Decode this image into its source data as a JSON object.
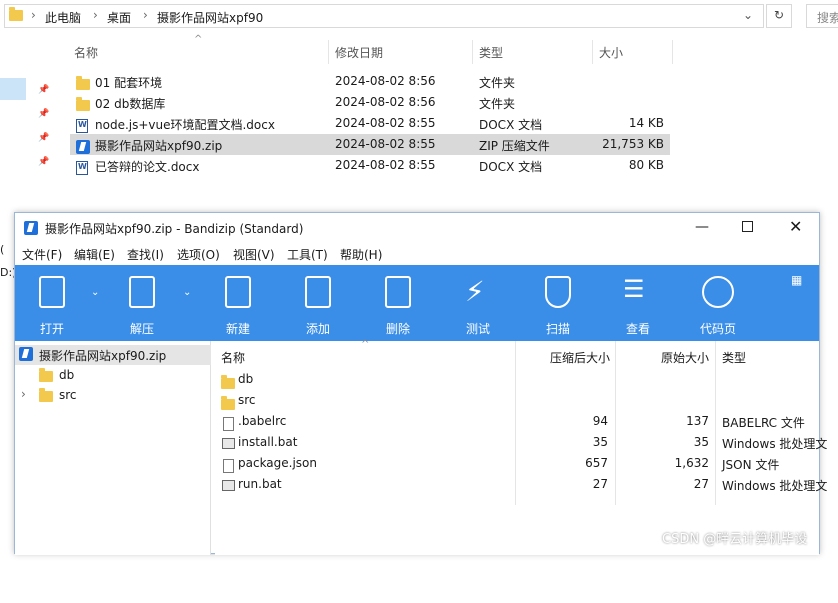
{
  "explorer": {
    "breadcrumb": [
      "此电脑",
      "桌面",
      "摄影作品网站xpf90"
    ],
    "search_placeholder": "搜索",
    "columns": {
      "name": "名称",
      "modified": "修改日期",
      "type": "类型",
      "size": "大小"
    },
    "files": [
      {
        "name": "01  配套环境",
        "modified": "2024-08-02 8:56",
        "type": "文件夹",
        "size": "",
        "icon": "folder-icon"
      },
      {
        "name": "02 db数据库",
        "modified": "2024-08-02 8:56",
        "type": "文件夹",
        "size": "",
        "icon": "folder-icon"
      },
      {
        "name": "node.js+vue环境配置文档.docx",
        "modified": "2024-08-02 8:55",
        "type": "DOCX 文档",
        "size": "14 KB",
        "icon": "word-icon"
      },
      {
        "name": "摄影作品网站xpf90.zip",
        "modified": "2024-08-02 8:55",
        "type": "ZIP 压缩文件",
        "size": "21,753 KB",
        "icon": "zip-icon",
        "selected": true
      },
      {
        "name": "已答辩的论文.docx",
        "modified": "2024-08-02 8:55",
        "type": "DOCX 文档",
        "size": "80 KB",
        "icon": "word-icon"
      }
    ],
    "left_fragments": {
      "a": "(",
      "b": "D:)"
    }
  },
  "bandizip": {
    "title": "摄影作品网站xpf90.zip - Bandizip (Standard)",
    "menu": [
      "文件(F)",
      "编辑(E)",
      "查找(I)",
      "选项(O)",
      "视图(V)",
      "工具(T)",
      "帮助(H)"
    ],
    "toolbar": [
      "打开",
      "解压",
      "新建",
      "添加",
      "删除",
      "测试",
      "扫描",
      "查看",
      "代码页"
    ],
    "tree": {
      "root": "摄影作品网站xpf90.zip",
      "children": [
        "db",
        "src"
      ]
    },
    "columns": {
      "name": "名称",
      "compressed": "压缩后大小",
      "original": "原始大小",
      "type": "类型"
    },
    "entries": [
      {
        "name": "db",
        "compressed": "",
        "original": "",
        "type": "",
        "icon": "folder-icon"
      },
      {
        "name": "src",
        "compressed": "",
        "original": "",
        "type": "",
        "icon": "folder-icon"
      },
      {
        "name": ".babelrc",
        "compressed": "94",
        "original": "137",
        "type": "BABELRC 文件",
        "icon": "file-icon"
      },
      {
        "name": "install.bat",
        "compressed": "35",
        "original": "35",
        "type": "Windows 批处理文",
        "icon": "bat-icon"
      },
      {
        "name": "package.json",
        "compressed": "657",
        "original": "1,632",
        "type": "JSON 文件",
        "icon": "file-icon"
      },
      {
        "name": "run.bat",
        "compressed": "27",
        "original": "27",
        "type": "Windows 批处理文",
        "icon": "bat-icon"
      }
    ]
  },
  "watermark": "CSDN @畔云计算机毕设",
  "colors": {
    "toolbar": "#3a8ee8",
    "selection": "#d9d9d9",
    "folder": "#f2c94c"
  }
}
